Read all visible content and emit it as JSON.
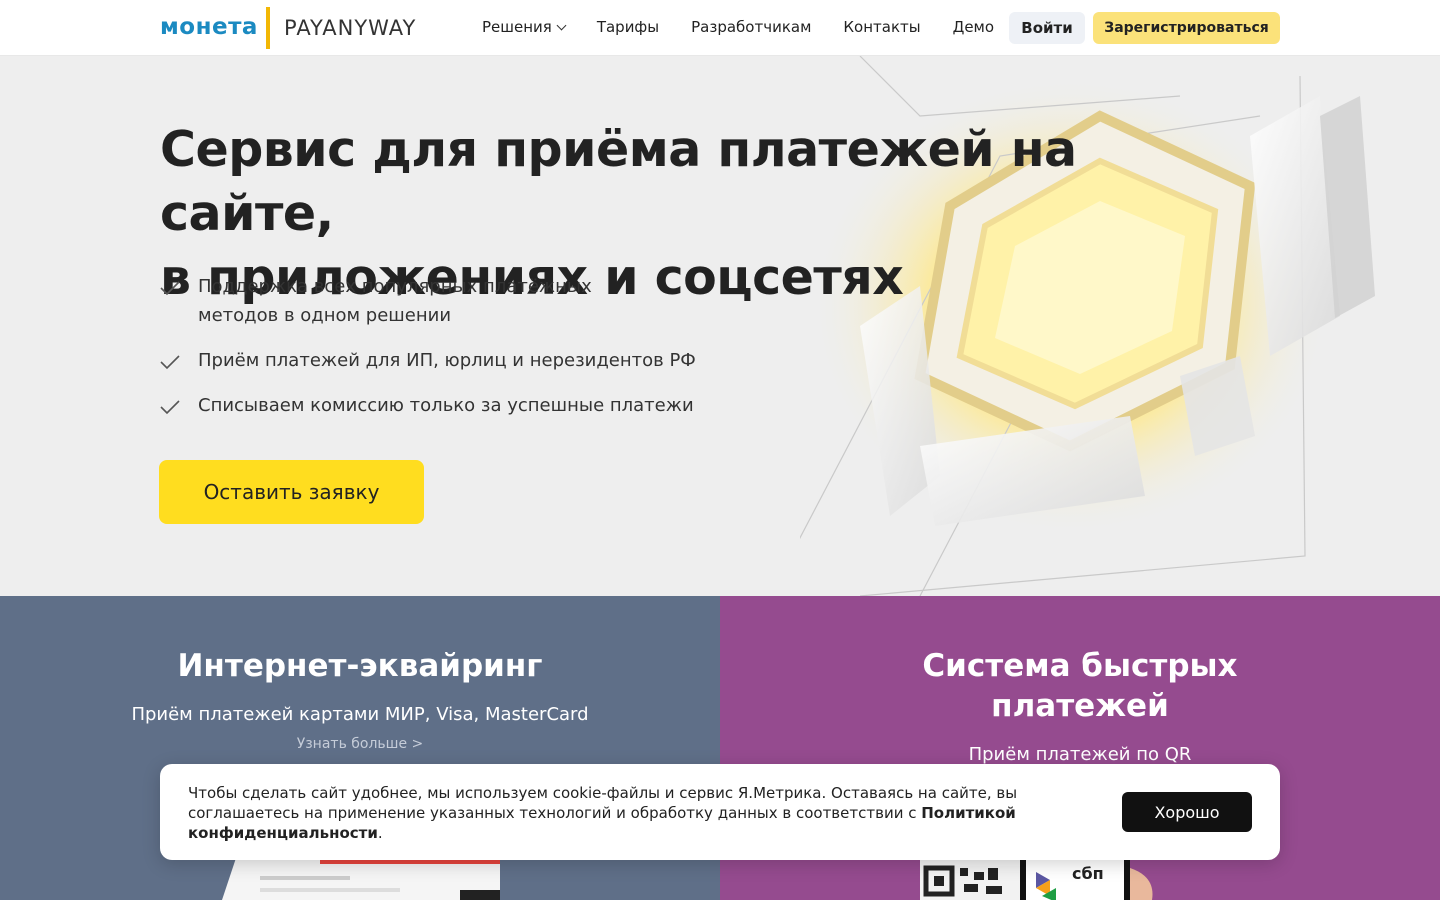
{
  "header": {
    "logo_moneta": "монета",
    "logo_payanyway": "PAYANYWAY",
    "nav": [
      "Решения",
      "Тарифы",
      "Разработчикам",
      "Контакты",
      "Демо"
    ],
    "login": "Войти",
    "register": "Зарегистрироваться"
  },
  "hero": {
    "title_line1": "Сервис для приёма платежей на сайте,",
    "title_line2": "в приложениях и соцсетях",
    "features": [
      "Поддержка всех популярных платёжных методов в одном решении",
      "Приём платежей для ИП, юрлиц и нерезидентов РФ",
      "Списываем комиссию только за успешные платежи"
    ],
    "cta": "Оставить заявку"
  },
  "blocks": {
    "acquiring": {
      "title": "Интернет-эквайринг",
      "subtitle": "Приём платежей картами МИР, Visa, MasterCard",
      "link": "Узнать больше >"
    },
    "sbp": {
      "title_line1": "Система быстрых",
      "title_line2": "платежей",
      "subtitle": "Приём платежей по QR",
      "sbp_logo": "сбп"
    }
  },
  "cookie": {
    "text": "Чтобы сделать сайт удобнее, мы используем cookie-файлы и сервис Я.Метрика. Оставаясь на сайте, вы соглашаетесь на применение указанных технологий и обработку данных в соответствии с ",
    "policy_link": "Политикой конфиденциальности",
    "period": ".",
    "button": "Хорошо"
  },
  "colors": {
    "brand_blue": "#1b8ac1",
    "accent_yellow": "#ffdd1f",
    "acquiring_bg": "#5f6f88",
    "sbp_bg": "#954b8f"
  }
}
